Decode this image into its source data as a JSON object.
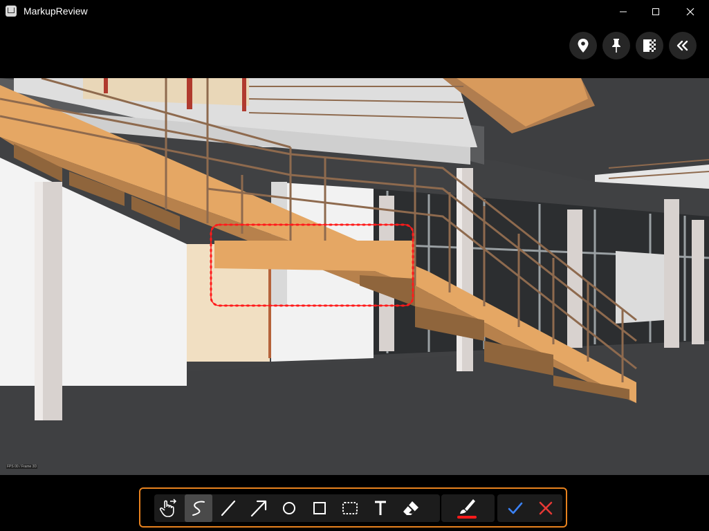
{
  "window": {
    "title": "MarkupReview",
    "controls": {
      "minimize": "minimize-icon",
      "maximize": "maximize-icon",
      "close": "close-icon"
    }
  },
  "right_controls": [
    {
      "name": "location-pin-button",
      "icon": "location-pin-icon"
    },
    {
      "name": "pin-button",
      "icon": "pushpin-icon"
    },
    {
      "name": "background-toggle-button",
      "icon": "checkered-gradient-icon"
    },
    {
      "name": "collapse-panel-button",
      "icon": "double-chevron-left-icon"
    }
  ],
  "viewport": {
    "corner_label": "FPS 00 / Frame 3D",
    "markup": {
      "shape": "cloud",
      "color": "#ff0000"
    }
  },
  "toolbar": {
    "border_color": "#e8821e",
    "tools": [
      {
        "name": "pan-tool",
        "icon": "hand-pointer-icon",
        "active": false
      },
      {
        "name": "freehand-tool",
        "icon": "freehand-icon",
        "active": true
      },
      {
        "name": "line-tool",
        "icon": "line-icon",
        "active": false
      },
      {
        "name": "arrow-tool",
        "icon": "arrow-icon",
        "active": false
      },
      {
        "name": "circle-tool",
        "icon": "circle-icon",
        "active": false
      },
      {
        "name": "rectangle-tool",
        "icon": "rectangle-icon",
        "active": false
      },
      {
        "name": "cloud-tool",
        "icon": "dashed-rectangle-icon",
        "active": false
      },
      {
        "name": "text-tool",
        "icon": "text-icon",
        "active": false
      },
      {
        "name": "eraser-tool",
        "icon": "eraser-icon",
        "active": false
      }
    ],
    "color": {
      "icon": "brush-icon",
      "value": "#ff0000"
    },
    "confirm": {
      "icon": "checkmark-icon",
      "color": "#3b82f6"
    },
    "cancel": {
      "icon": "x-icon",
      "color": "#e53935"
    }
  }
}
